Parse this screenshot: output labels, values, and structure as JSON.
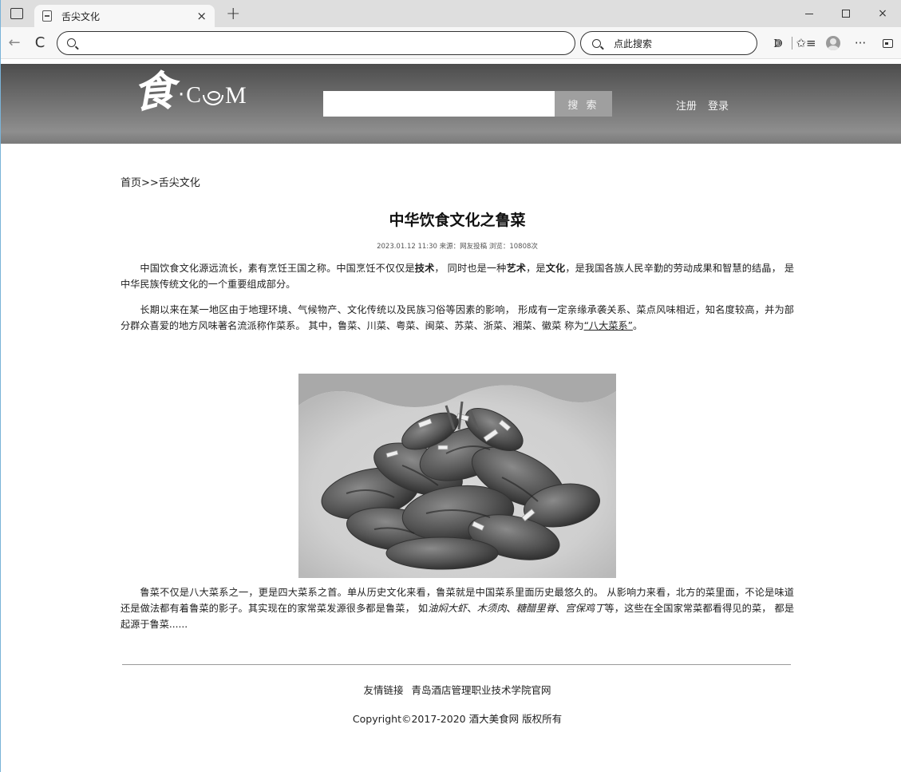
{
  "browser": {
    "tab_title": "舌尖文化",
    "close_glyph": "×",
    "new_tab_glyph": "+",
    "address_value": "",
    "side_search_label": "点此搜索",
    "more_glyph": "···",
    "controls": {
      "minimize": "",
      "maximize": "",
      "close": "×"
    },
    "icons": {
      "back": "←",
      "refresh": "C",
      "favorites": "✩≡",
      "refresh_ext": "ↇ"
    }
  },
  "site": {
    "logo": {
      "char": "食",
      "dot": "·",
      "c": "C",
      "m": "M"
    },
    "search_placeholder": "",
    "search_button": "搜 索",
    "register": "注册",
    "login": "登录"
  },
  "article": {
    "breadcrumb": "首页>>舌尖文化",
    "title": "中华饮食文化之鲁菜",
    "meta": "2023.01.12 11:30 来源：网友投稿 浏览：10808次",
    "p1": {
      "a": "中国饮食文化源远流长，素有烹饪王国之称。中国烹饪不仅仅是",
      "b1": "技术",
      "c": "， 同时也是一种",
      "b2": "艺术",
      "d": "，是",
      "b3": "文化",
      "e": "，是我国各族人民辛勤的劳动成果和智慧的结晶， 是中华民族传统文化的一个重要组成部分。"
    },
    "p2": {
      "a": "长期以来在某一地区由于地理环境、气候物产、文化传统以及民族习俗等因素的影响， 形成有一定亲缘承袭关系、菜点风味相近，知名度较高，并为部分群众喜爱的地方风味著名流派称作菜系。 其中，鲁菜、川菜、粤菜、闽菜、苏菜、浙菜、湘菜、徽菜 称为",
      "link": "“八大菜系”",
      "end": "。"
    },
    "p3": {
      "a": "鲁菜不仅是八大菜系之一，更是四大菜系之首。单从历史文化来看，鲁菜就是中国菜系里面历史最悠久的。 从影响力来看，北方的菜里面，不论是味道还是做法都有着鲁菜的影子。其实现在的家常菜发源很多都是鲁菜， 如",
      "i1": "油焖大虾",
      "s1": "、",
      "i2": "木须肉",
      "s2": "、",
      "i3": "糖醋里脊",
      "s3": "、",
      "i4": "宫保鸡丁",
      "end": "等，这些在全国家常菜都看得见的菜， 都是起源于鲁菜......"
    }
  },
  "footer": {
    "links_label": "友情链接",
    "link1": "青岛酒店管理职业技术学院官网",
    "copyright": "Copyright©2017-2020   酒大美食网 版权所有"
  }
}
